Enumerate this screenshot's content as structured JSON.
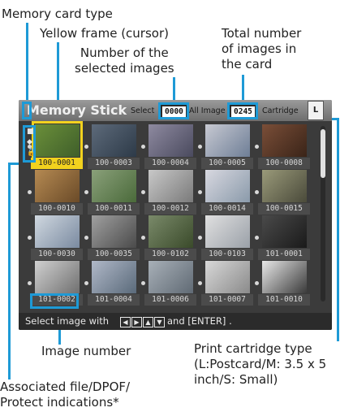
{
  "callouts": {
    "memory_card_type": "Memory card type",
    "yellow_frame": "Yellow frame (cursor)",
    "selected_count": "Number of the\nselected images",
    "total_count": "Total number\nof images in\nthe card",
    "image_number": "Image number",
    "print_cartridge": "Print cartridge type\n(L:Postcard/M: 3.5 x 5\ninch/S: Small)",
    "indications": "Associated file/DPOF/\nProtect indications*"
  },
  "screen": {
    "media_name": "Memory Stick",
    "select_label": "Select",
    "selected_value": "0000",
    "all_images_label": "All Image",
    "total_value": "0245",
    "cartridge_label": "Cartridge",
    "cartridge_type": "L",
    "footer": {
      "prefix": "Select image with",
      "suffix": "and [ENTER] ."
    },
    "thumbnails": [
      {
        "num": "100-0001",
        "selected": true
      },
      {
        "num": "100-0003"
      },
      {
        "num": "100-0004"
      },
      {
        "num": "100-0005"
      },
      {
        "num": "100-0008"
      },
      {
        "num": "100-0010"
      },
      {
        "num": "100-0011"
      },
      {
        "num": "100-0012"
      },
      {
        "num": "100-0014"
      },
      {
        "num": "100-0015"
      },
      {
        "num": "100-0030"
      },
      {
        "num": "100-0035"
      },
      {
        "num": "100-0102"
      },
      {
        "num": "100-0103"
      },
      {
        "num": "101-0001"
      },
      {
        "num": "101-0002",
        "highlighted": true
      },
      {
        "num": "101-0004"
      },
      {
        "num": "101-0006"
      },
      {
        "num": "101-0007"
      },
      {
        "num": "101-0010"
      }
    ]
  },
  "colors": {
    "accent": "#1e9ad6",
    "cursor": "#f2d21e",
    "screen_bg": "#3b3b3b"
  }
}
